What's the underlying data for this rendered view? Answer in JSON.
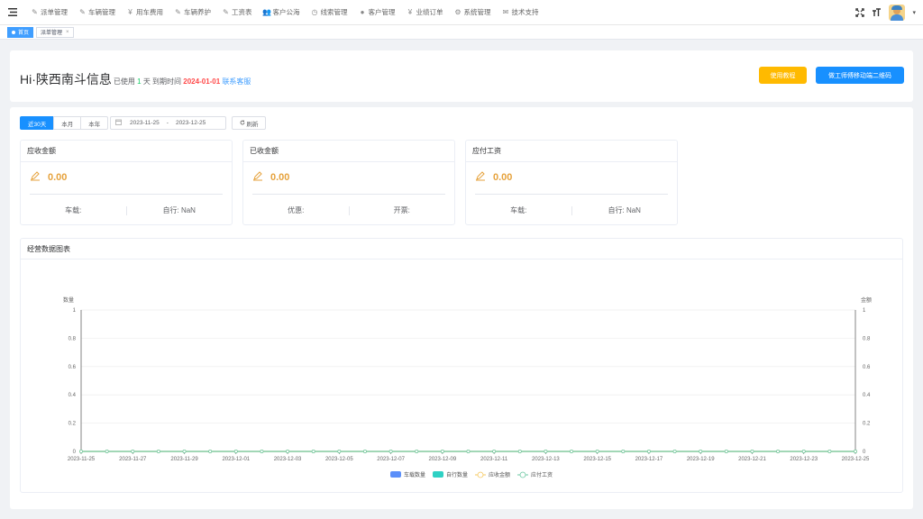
{
  "nav": {
    "items": [
      {
        "label": "派单管理",
        "icon": "edit-icon"
      },
      {
        "label": "车辆管理",
        "icon": "edit-icon"
      },
      {
        "label": "用车费用",
        "icon": "yen-icon"
      },
      {
        "label": "车辆养护",
        "icon": "edit-icon"
      },
      {
        "label": "工资表",
        "icon": "edit-icon"
      },
      {
        "label": "客户公海",
        "icon": "users-icon"
      },
      {
        "label": "线索管理",
        "icon": "clock-icon"
      },
      {
        "label": "客户管理",
        "icon": "user-icon"
      },
      {
        "label": "业绩订单",
        "icon": "yen-icon"
      },
      {
        "label": "系统管理",
        "icon": "gear-icon"
      },
      {
        "label": "技术支持",
        "icon": "wechat-icon"
      }
    ]
  },
  "tabs": [
    {
      "label": "首页",
      "active": true
    },
    {
      "label": "派单管理",
      "active": false,
      "close": "×"
    }
  ],
  "welcome": {
    "hi": "Hi·陕西南斗信息",
    "used_prefix": "已使用",
    "used_days": "1",
    "used_suffix": "天 到期时间",
    "expire_date": "2024-01-01",
    "contact": "联系客服",
    "tutorial_btn": "使用教程",
    "qr_btn": "做工师傅移动端二维码"
  },
  "filters": {
    "ranges": [
      "近30天",
      "本月",
      "本年"
    ],
    "active_range": "近30天",
    "start_date": "2023-11-25",
    "separator": "-",
    "end_date": "2023-12-25",
    "refresh": "刷新"
  },
  "stats": [
    {
      "title": "应收金额",
      "amount": "0.00",
      "left_label": "车载:",
      "right_label": "自行: NaN"
    },
    {
      "title": "已收金额",
      "amount": "0.00",
      "left_label": "优惠:",
      "right_label": "开票:"
    },
    {
      "title": "应付工资",
      "amount": "0.00",
      "left_label": "车载:",
      "right_label": "自行: NaN"
    }
  ],
  "chart_title": "经营数据图表",
  "colors": {
    "primary": "#1890ff",
    "warning": "#ffba00",
    "amount": "#e6a23c",
    "series_car": "#5b8ff9",
    "series_self": "#2fd1c4",
    "series_receivable": "#f6c85f",
    "series_wage": "#6dc8a3"
  },
  "chart_data": {
    "type": "line",
    "x": [
      "2023-11-25",
      "2023-11-26",
      "2023-11-27",
      "2023-11-28",
      "2023-11-29",
      "2023-11-30",
      "2023-12-01",
      "2023-12-02",
      "2023-12-03",
      "2023-12-04",
      "2023-12-05",
      "2023-12-06",
      "2023-12-07",
      "2023-12-08",
      "2023-12-09",
      "2023-12-10",
      "2023-12-11",
      "2023-12-12",
      "2023-12-13",
      "2023-12-14",
      "2023-12-15",
      "2023-12-16",
      "2023-12-17",
      "2023-12-18",
      "2023-12-19",
      "2023-12-20",
      "2023-12-21",
      "2023-12-22",
      "2023-12-23",
      "2023-12-24",
      "2023-12-25"
    ],
    "x_tick_labels": [
      "2023-11-25",
      "2023-11-27",
      "2023-11-29",
      "2023-12-01",
      "2023-12-03",
      "2023-12-05",
      "2023-12-07",
      "2023-12-09",
      "2023-12-11",
      "2023-12-13",
      "2023-12-15",
      "2023-12-17",
      "2023-12-19",
      "2023-12-21",
      "2023-12-23",
      "2023-12-25"
    ],
    "ylabel_left": "数量",
    "ylabel_right": "金额",
    "ylim": [
      0,
      1
    ],
    "yticks": [
      "0",
      "0.2",
      "0.4",
      "0.6",
      "0.8",
      "1"
    ],
    "series": [
      {
        "name": "车载数量",
        "kind": "bar",
        "values": [
          0,
          0,
          0,
          0,
          0,
          0,
          0,
          0,
          0,
          0,
          0,
          0,
          0,
          0,
          0,
          0,
          0,
          0,
          0,
          0,
          0,
          0,
          0,
          0,
          0,
          0,
          0,
          0,
          0,
          0,
          0
        ]
      },
      {
        "name": "自行数量",
        "kind": "bar",
        "values": [
          0,
          0,
          0,
          0,
          0,
          0,
          0,
          0,
          0,
          0,
          0,
          0,
          0,
          0,
          0,
          0,
          0,
          0,
          0,
          0,
          0,
          0,
          0,
          0,
          0,
          0,
          0,
          0,
          0,
          0,
          0
        ]
      },
      {
        "name": "应收金额",
        "kind": "line",
        "values": [
          0,
          0,
          0,
          0,
          0,
          0,
          0,
          0,
          0,
          0,
          0,
          0,
          0,
          0,
          0,
          0,
          0,
          0,
          0,
          0,
          0,
          0,
          0,
          0,
          0,
          0,
          0,
          0,
          0,
          0,
          0
        ]
      },
      {
        "name": "应付工资",
        "kind": "line",
        "values": [
          0,
          0,
          0,
          0,
          0,
          0,
          0,
          0,
          0,
          0,
          0,
          0,
          0,
          0,
          0,
          0,
          0,
          0,
          0,
          0,
          0,
          0,
          0,
          0,
          0,
          0,
          0,
          0,
          0,
          0,
          0
        ]
      }
    ],
    "legend_position": "bottom-center",
    "grid": true
  }
}
